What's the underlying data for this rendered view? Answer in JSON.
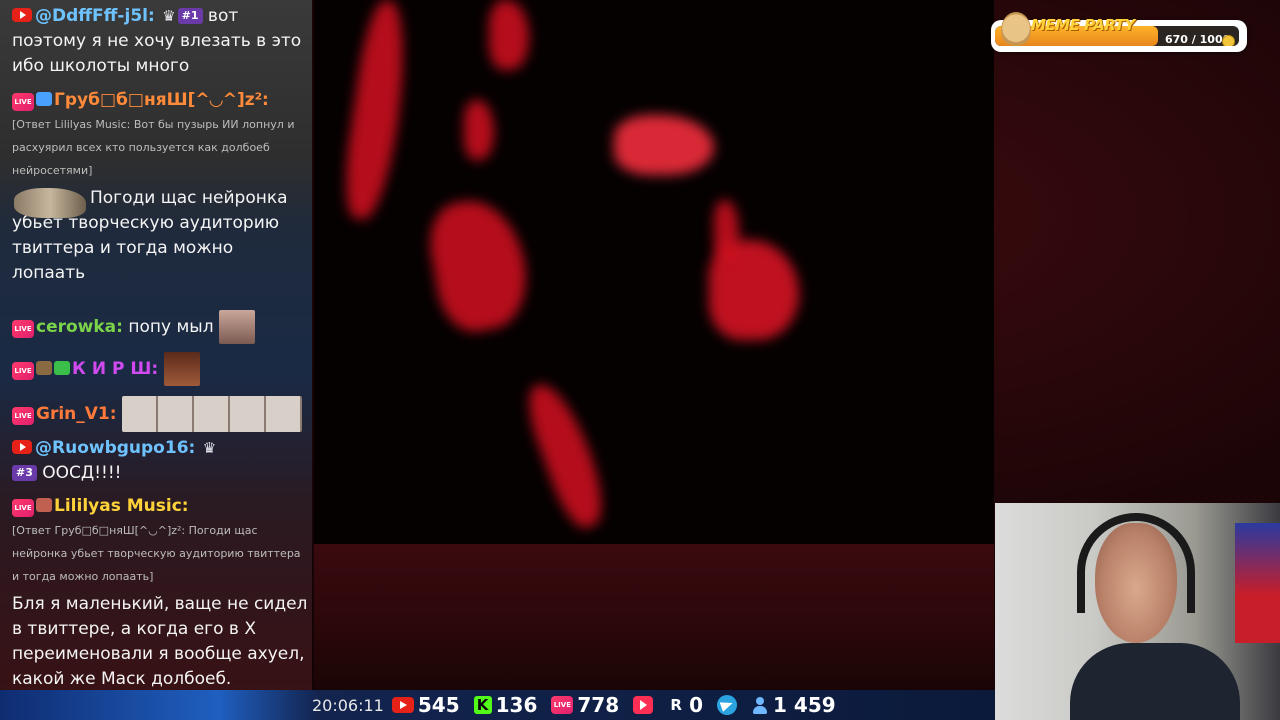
{
  "chat": {
    "messages": [
      {
        "platform": "youtube",
        "user": "@DdffFff-j5l:",
        "user_color": "#6ec3ff",
        "badges": [
          "crown",
          "#1"
        ],
        "text": "вот"
      },
      {
        "continuation": "поэтому я не хочу влезать в это ибо школоты много"
      },
      {
        "platform": "live",
        "user": "Груб□б□няШ[^◡^]z²:",
        "user_color": "#ff8a3a",
        "reply": "[Ответ Lililyas Music: Вот бы пузырь ИИ лопнул и расхуярил всех кто пользуется как долбоеб нейросетями]",
        "text": "Погоди щас нейронка убьет творческую аудиторию твиттера и тогда можно лопаать"
      },
      {
        "platform": "live",
        "user": "cerowka:",
        "user_color": "#7bd34a",
        "text": "попу мыл"
      },
      {
        "platform": "live",
        "user": "К И Р Ш:",
        "user_color": "#d04af0",
        "text": ""
      },
      {
        "platform": "live",
        "user": "Grin_V1:",
        "user_color": "#ff7a3a",
        "text": ""
      },
      {
        "platform": "youtube",
        "user": "@Ruowbgupo16:",
        "user_color": "#6ec3ff",
        "badges": [
          "crown",
          "#3"
        ],
        "text": "ООСД!!!!"
      },
      {
        "platform": "live",
        "user": "Lililyas Music:",
        "user_color": "#ffd23a",
        "reply": "[Ответ Груб□б□няШ[^◡^]z²: Погоди щас нейронка убьет творческую аудиторию твиттера и тогда можно лопаать]",
        "text": "Бля я маленький, ваще не сидел в твиттере, а когда его в Х переименовали я вообще ахуел, какой же Маск долбоеб."
      }
    ]
  },
  "widget": {
    "logo": "MEME PARTY",
    "progress_text": "670 / 1000",
    "progress_value": 670,
    "progress_max": 1000
  },
  "stats": {
    "time": "20:06:11",
    "youtube": "545",
    "kick": "136",
    "live": "778",
    "rutube": "0",
    "r_label": "R",
    "r_value": "0",
    "total": "1 459",
    "kick_letter": "K",
    "live_label": "LIVE"
  },
  "colors": {
    "youtube_red": "#e62117",
    "kick_green": "#53fc18",
    "meme_orange": "#ffb32a"
  }
}
